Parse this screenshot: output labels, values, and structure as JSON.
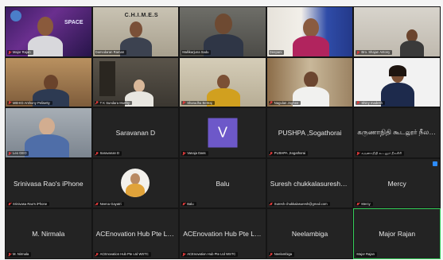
{
  "tiles": [
    {
      "name": "Major Rajan"
    },
    {
      "name": "Damodaran Raman",
      "banner": "C.H.I.M.E.S"
    },
    {
      "name": "Mallikarjuna Sadu"
    },
    {
      "name": "Deepani"
    },
    {
      "name": "Bro. Shajan Antony"
    },
    {
      "name": "MEHID Anthony Pelisetty"
    },
    {
      "name": "T K Sundara Murthy"
    },
    {
      "name": "Sharadha Bettraj"
    },
    {
      "name": "Nagulan Joghee"
    },
    {
      "name": "Shiny madesh"
    },
    {
      "name": "Leo GEO"
    },
    {
      "name": "Saravanan D",
      "center": "Saravanan D"
    },
    {
      "name": "Vanaja Dass",
      "avatar_letter": "V"
    },
    {
      "name": "PUSHPA ,Sogathorai",
      "center": "PUSHPA ,Sogathorai"
    },
    {
      "name": "கருணாநிதி கூடலூர் நீலகிரி",
      "center": "கருணாநிதி கூடலூர் நீலகிரி"
    },
    {
      "name": "Srinivasa Rao's iPhone",
      "center": "Srinivasa Rao's iPhone"
    },
    {
      "name": "Neena Gayatri"
    },
    {
      "name": "Balu",
      "center": "Balu"
    },
    {
      "name": "Suresh chukkalasuresh@gmail.com",
      "center": "Suresh chukkalasuresh@g..."
    },
    {
      "name": "Mercy",
      "center": "Mercy"
    },
    {
      "name": "M. Nirmala",
      "center": "M. Nirmala"
    },
    {
      "name": "ACEnovation Hub Pte Ltd WSTC",
      "center": "ACEnovation Hub Pte Ltd W..."
    },
    {
      "name": "ACEnovation Hub Pte Ltd WSTC",
      "center": "ACEnovation Hub Pte Ltd W..."
    },
    {
      "name": "Neelambiga",
      "center": "Neelambiga"
    },
    {
      "name": "Major Rajan",
      "center": "Major Rajan"
    }
  ],
  "colors": {
    "active_speaker": "#35d05a",
    "muted": "#e03a3a",
    "avatar": "#6d58c9",
    "pin": "#2d8cff"
  }
}
